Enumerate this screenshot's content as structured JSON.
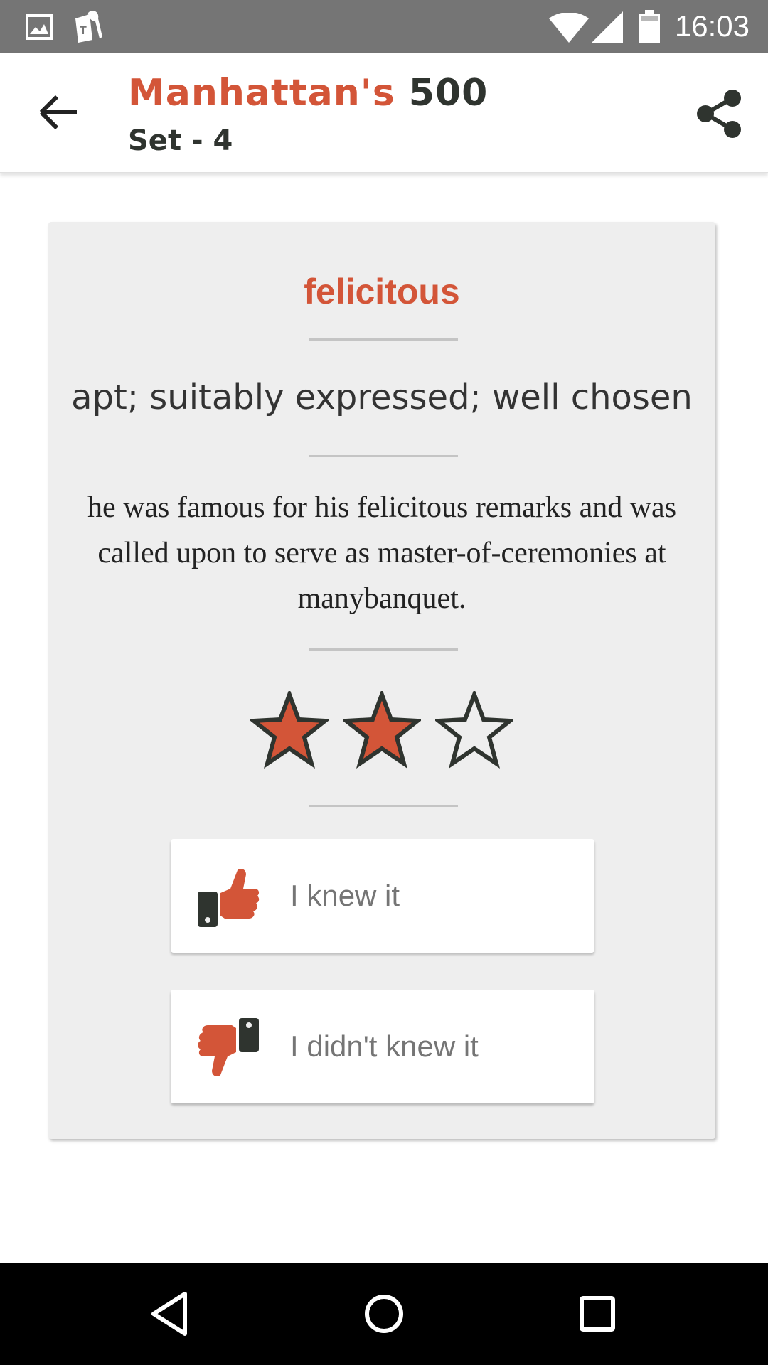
{
  "status_bar": {
    "time": "16:03",
    "icons": [
      "image-icon",
      "t-mobile-keys-icon",
      "wifi-icon",
      "cell-signal-icon",
      "battery-icon"
    ]
  },
  "app_bar": {
    "title_brand": "Manhattan's",
    "title_number": " 500",
    "subtitle": "Set - 4",
    "icons": [
      "back-arrow-icon",
      "share-icon"
    ]
  },
  "card": {
    "word": "felicitous",
    "definition": "apt; suitably expressed; well chosen",
    "example": "he was famous for his felicitous remarks and was called upon to serve as master-of-ceremonies at manybanquet.",
    "rating": {
      "filled": 2,
      "total": 3
    },
    "knew_label": "I knew it",
    "didnt_know_label": "I didn't knew it"
  },
  "nav_bar": {
    "icons": [
      "back-triangle-icon",
      "home-circle-icon",
      "recents-square-icon"
    ]
  },
  "colors": {
    "accent": "#d35538",
    "dark": "#2f342f",
    "card_bg": "#eeeeee",
    "status_bar": "#757575"
  }
}
